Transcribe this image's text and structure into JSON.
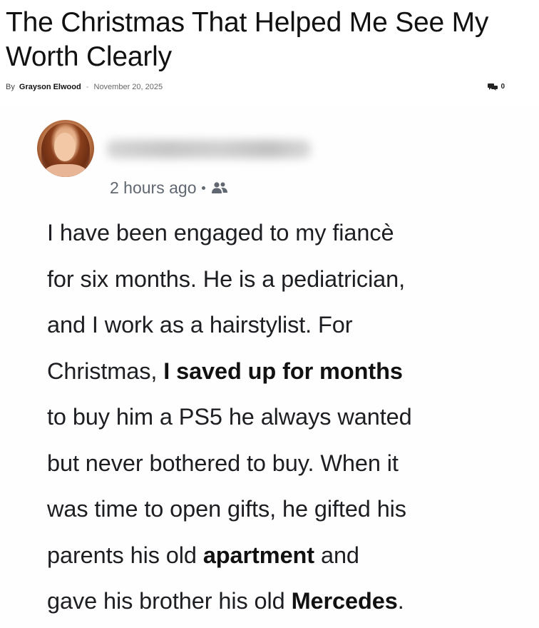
{
  "article": {
    "title": "The Christmas That Helped Me See My Worth Clearly",
    "by_label": "By",
    "author": "Grayson Elwood",
    "separator": "-",
    "date": "November 20, 2025",
    "comment_count": "0"
  },
  "post": {
    "time": "2 hours ago",
    "icons": {
      "avatar": "avatar-photo",
      "privacy": "friends-icon",
      "comments": "comment-icon"
    },
    "text_lines": [
      [
        {
          "t": "I have been engaged to my fiancè"
        }
      ],
      [
        {
          "t": "for six months. He is a pediatrician,"
        }
      ],
      [
        {
          "t": "and I work as a hairstylist. For"
        }
      ],
      [
        {
          "t": "Christmas, "
        },
        {
          "t": "I saved up for months",
          "b": true
        }
      ],
      [
        {
          "t": "to buy him a PS5 he always wanted"
        }
      ],
      [
        {
          "t": "but never bothered to buy. When it"
        }
      ],
      [
        {
          "t": "was time to open gifts, he gifted his"
        }
      ],
      [
        {
          "t": "parents his old "
        },
        {
          "t": "apartment",
          "b": true
        },
        {
          "t": " and"
        }
      ],
      [
        {
          "t": "gave his brother his old "
        },
        {
          "t": "Mercedes",
          "b": true
        },
        {
          "t": "."
        }
      ]
    ]
  }
}
